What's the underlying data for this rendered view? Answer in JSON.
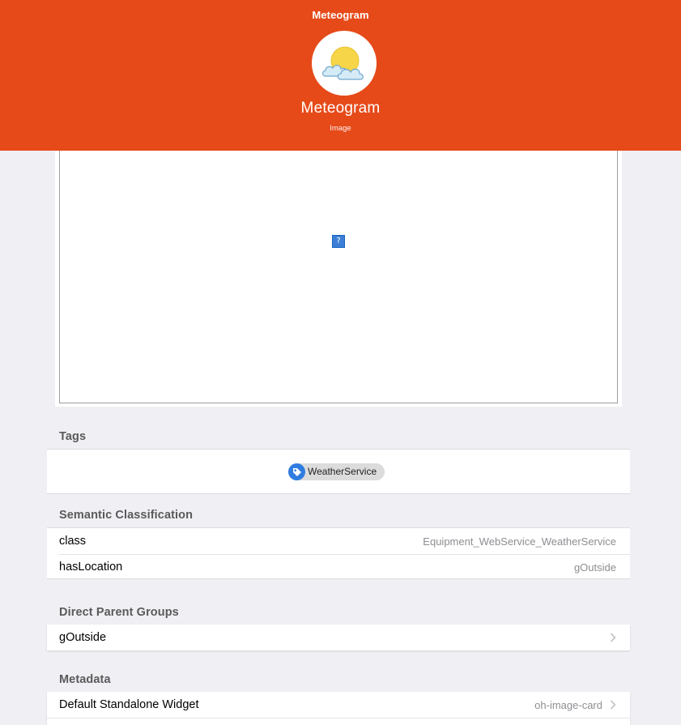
{
  "header": {
    "nav_title": "Meteogram",
    "item_label": "Meteogram",
    "item_type": "Image",
    "avatar_icon": "weather-sun-cloud-icon",
    "background_color": "#e64a19"
  },
  "image_view": {
    "broken_icon": "?"
  },
  "tags": {
    "title": "Tags",
    "items": [
      {
        "label": "WeatherService",
        "icon": "tag-icon"
      }
    ]
  },
  "semantic": {
    "title": "Semantic Classification",
    "rows": [
      {
        "label": "class",
        "value": "Equipment_WebService_WeatherService"
      },
      {
        "label": "hasLocation",
        "value": "gOutside"
      }
    ]
  },
  "parent_groups": {
    "title": "Direct Parent Groups",
    "rows": [
      {
        "label": "gOutside"
      }
    ]
  },
  "metadata": {
    "title": "Metadata",
    "rows": [
      {
        "label": "Default Standalone Widget",
        "value": "oh-image-card"
      }
    ]
  }
}
